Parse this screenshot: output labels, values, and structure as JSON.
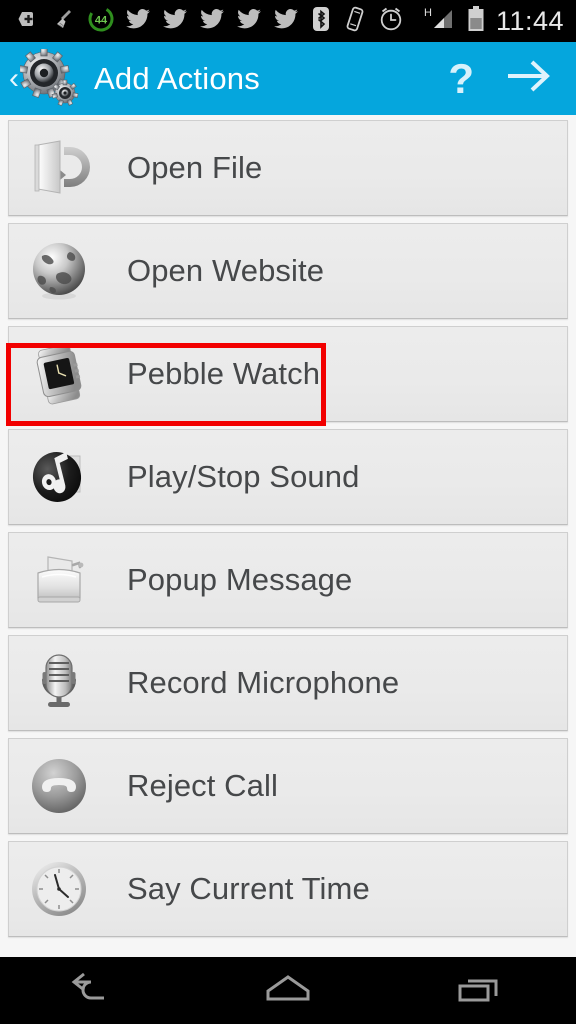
{
  "status_bar": {
    "icons": [
      {
        "name": "plus-badge-icon",
        "label": "add"
      },
      {
        "name": "broom-cleaner-icon",
        "label": "cleaner"
      },
      {
        "name": "battery-saver-circle-icon",
        "label": "44"
      },
      {
        "name": "twitter-bird-icon",
        "label": "twitter"
      },
      {
        "name": "twitter-bird-icon",
        "label": "twitter"
      },
      {
        "name": "twitter-bird-icon",
        "label": "twitter"
      },
      {
        "name": "twitter-bird-icon",
        "label": "twitter"
      },
      {
        "name": "twitter-bird-icon",
        "label": "twitter"
      },
      {
        "name": "bluetooth-icon",
        "label": "bluetooth"
      },
      {
        "name": "vibrate-icon",
        "label": "vibrate"
      },
      {
        "name": "alarm-clock-icon",
        "label": "alarm"
      }
    ],
    "battery_badge": "44",
    "network_type": "H",
    "clock": "11:44"
  },
  "action_bar": {
    "back_label": "‹",
    "app_icon": "gears-icon",
    "title": "Add Actions",
    "help_label": "?",
    "next_icon": "arrow-right-icon",
    "background_color": "#05a6dd"
  },
  "list": {
    "highlight_color": "#f20000",
    "highlighted_index": 1,
    "items": [
      {
        "label": "Open File",
        "icon": "open-folder-icon"
      },
      {
        "label": "Open Website",
        "icon": "globe-icon"
      },
      {
        "label": "Pebble Watch",
        "icon": "smartwatch-icon"
      },
      {
        "label": "Play/Stop Sound",
        "icon": "music-note-vinyl-icon"
      },
      {
        "label": "Popup Message",
        "icon": "toaster-popup-icon"
      },
      {
        "label": "Record Microphone",
        "icon": "microphone-icon"
      },
      {
        "label": "Reject Call",
        "icon": "phone-handset-icon"
      },
      {
        "label": "Say Current Time",
        "icon": "analog-clock-icon"
      }
    ]
  },
  "nav_bar": {
    "back": "nav-back-icon",
    "home": "nav-home-icon",
    "recents": "nav-recents-icon"
  }
}
